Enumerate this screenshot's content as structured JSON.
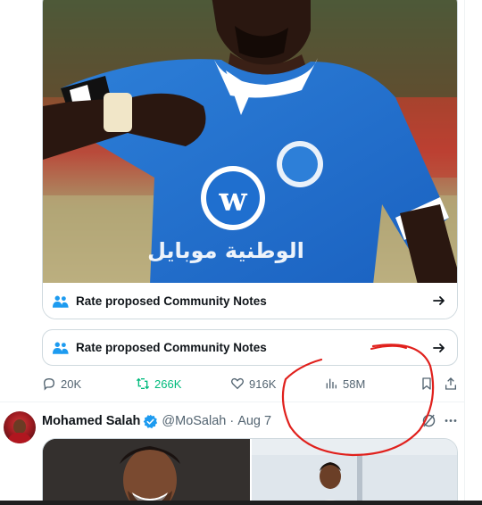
{
  "tweet1": {
    "community_note_in_media": "Rate proposed Community Notes",
    "community_note_card": "Rate proposed Community Notes",
    "photo": {
      "jersey_text": "الوطنية موبايل",
      "badge_letter": "w"
    },
    "actions": {
      "replies": "20K",
      "reposts": "266K",
      "likes": "916K",
      "views": "58M"
    }
  },
  "tweet2": {
    "author_name": "Mohamed Salah",
    "handle": "@MoSalah",
    "separator": "·",
    "date": "Aug 7"
  },
  "colors": {
    "accent_blue": "#1d9bf0",
    "repost_green": "#00ba7c",
    "muted_text": "#536471",
    "annotation_red": "#e0201c"
  }
}
